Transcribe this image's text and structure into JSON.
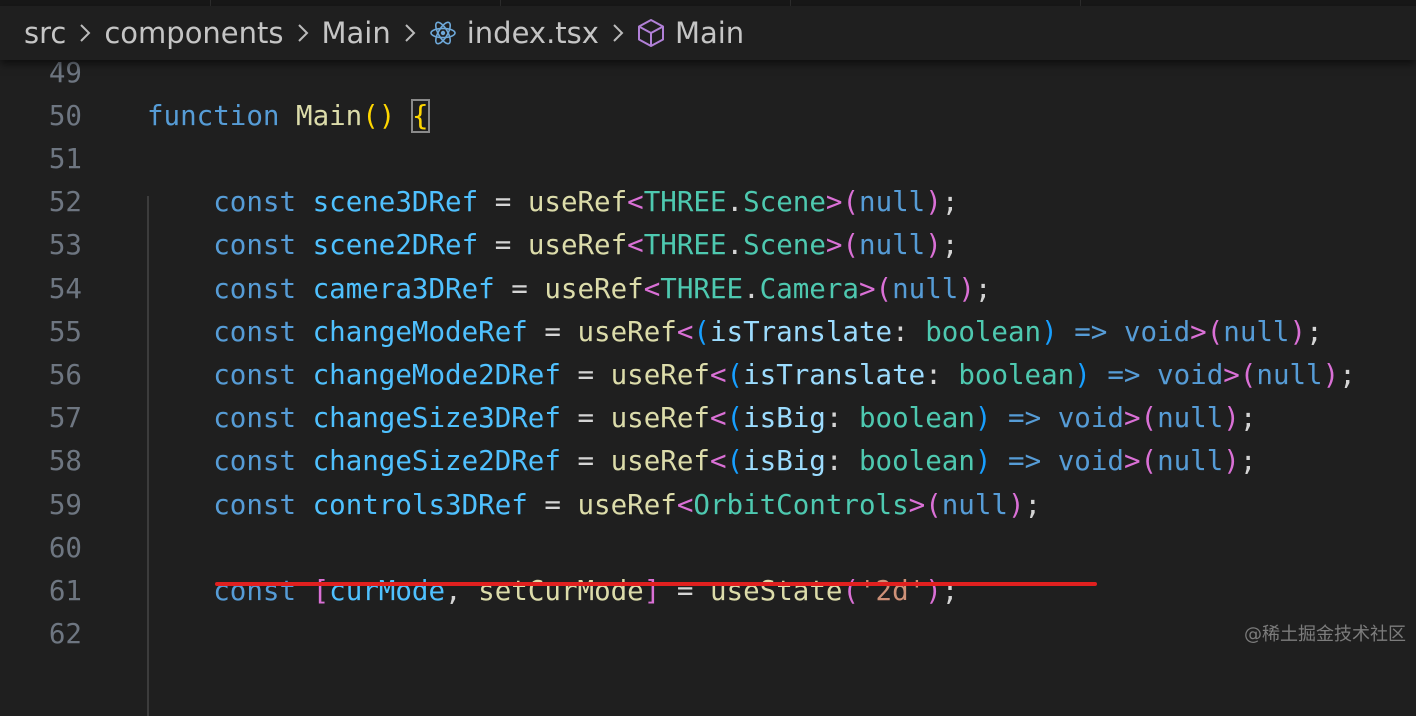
{
  "colors": {
    "background": "#1f1f1f",
    "line_number": "#6e7681",
    "keyword_blue": "#569cd6",
    "identifier": "#4fc1ff",
    "variable": "#9cdcfe",
    "function": "#dcdcaa",
    "type": "#4ec9b0",
    "bracket_gold": "#ffd700",
    "bracket_pink": "#da70d6",
    "bracket_cyan": "#179fff",
    "string": "#ce9178",
    "punct": "#d4d4d4",
    "highlight_underline": "#e0201f"
  },
  "breadcrumb": {
    "items": [
      {
        "label": "src",
        "icon": null
      },
      {
        "label": "components",
        "icon": null
      },
      {
        "label": "Main",
        "icon": null
      },
      {
        "label": "index.tsx",
        "icon": "react-icon"
      },
      {
        "label": "Main",
        "icon": "cube-icon"
      }
    ],
    "separator_icon": "chevron-right-icon"
  },
  "code_lines": [
    {
      "n": "49",
      "tokens": []
    },
    {
      "n": "50",
      "tokens": [
        {
          "t": "function",
          "c": "keyword_blue"
        },
        {
          "t": " ",
          "c": "punct"
        },
        {
          "t": "Main",
          "c": "function"
        },
        {
          "t": "()",
          "c": "bracket_gold"
        },
        {
          "t": " ",
          "c": "punct"
        },
        {
          "t": "{",
          "c": "bracket_gold",
          "box": true
        }
      ]
    },
    {
      "n": "51",
      "tokens": []
    },
    {
      "n": "52",
      "tokens": [
        {
          "t": "    const",
          "c": "keyword_blue"
        },
        {
          "t": " ",
          "c": "punct"
        },
        {
          "t": "scene3DRef",
          "c": "identifier"
        },
        {
          "t": " = ",
          "c": "punct"
        },
        {
          "t": "useRef",
          "c": "function"
        },
        {
          "t": "<",
          "c": "bracket_pink"
        },
        {
          "t": "THREE",
          "c": "type"
        },
        {
          "t": ".",
          "c": "punct"
        },
        {
          "t": "Scene",
          "c": "type"
        },
        {
          "t": ">",
          "c": "bracket_pink"
        },
        {
          "t": "(",
          "c": "bracket_pink"
        },
        {
          "t": "null",
          "c": "keyword_blue"
        },
        {
          "t": ")",
          "c": "bracket_pink"
        },
        {
          "t": ";",
          "c": "punct"
        }
      ]
    },
    {
      "n": "53",
      "tokens": [
        {
          "t": "    const",
          "c": "keyword_blue"
        },
        {
          "t": " ",
          "c": "punct"
        },
        {
          "t": "scene2DRef",
          "c": "identifier"
        },
        {
          "t": " = ",
          "c": "punct"
        },
        {
          "t": "useRef",
          "c": "function"
        },
        {
          "t": "<",
          "c": "bracket_pink"
        },
        {
          "t": "THREE",
          "c": "type"
        },
        {
          "t": ".",
          "c": "punct"
        },
        {
          "t": "Scene",
          "c": "type"
        },
        {
          "t": ">",
          "c": "bracket_pink"
        },
        {
          "t": "(",
          "c": "bracket_pink"
        },
        {
          "t": "null",
          "c": "keyword_blue"
        },
        {
          "t": ")",
          "c": "bracket_pink"
        },
        {
          "t": ";",
          "c": "punct"
        }
      ]
    },
    {
      "n": "54",
      "tokens": [
        {
          "t": "    const",
          "c": "keyword_blue"
        },
        {
          "t": " ",
          "c": "punct"
        },
        {
          "t": "camera3DRef",
          "c": "identifier"
        },
        {
          "t": " = ",
          "c": "punct"
        },
        {
          "t": "useRef",
          "c": "function"
        },
        {
          "t": "<",
          "c": "bracket_pink"
        },
        {
          "t": "THREE",
          "c": "type"
        },
        {
          "t": ".",
          "c": "punct"
        },
        {
          "t": "Camera",
          "c": "type"
        },
        {
          "t": ">",
          "c": "bracket_pink"
        },
        {
          "t": "(",
          "c": "bracket_pink"
        },
        {
          "t": "null",
          "c": "keyword_blue"
        },
        {
          "t": ")",
          "c": "bracket_pink"
        },
        {
          "t": ";",
          "c": "punct"
        }
      ]
    },
    {
      "n": "55",
      "tokens": [
        {
          "t": "    const",
          "c": "keyword_blue"
        },
        {
          "t": " ",
          "c": "punct"
        },
        {
          "t": "changeModeRef",
          "c": "identifier"
        },
        {
          "t": " = ",
          "c": "punct"
        },
        {
          "t": "useRef",
          "c": "function"
        },
        {
          "t": "<",
          "c": "bracket_pink"
        },
        {
          "t": "(",
          "c": "bracket_cyan"
        },
        {
          "t": "isTranslate",
          "c": "variable"
        },
        {
          "t": ": ",
          "c": "punct"
        },
        {
          "t": "boolean",
          "c": "type"
        },
        {
          "t": ")",
          "c": "bracket_cyan"
        },
        {
          "t": " => ",
          "c": "keyword_blue"
        },
        {
          "t": "void",
          "c": "keyword_blue"
        },
        {
          "t": ">",
          "c": "bracket_pink"
        },
        {
          "t": "(",
          "c": "bracket_pink"
        },
        {
          "t": "null",
          "c": "keyword_blue"
        },
        {
          "t": ")",
          "c": "bracket_pink"
        },
        {
          "t": ";",
          "c": "punct"
        }
      ]
    },
    {
      "n": "56",
      "tokens": [
        {
          "t": "    const",
          "c": "keyword_blue"
        },
        {
          "t": " ",
          "c": "punct"
        },
        {
          "t": "changeMode2DRef",
          "c": "identifier"
        },
        {
          "t": " = ",
          "c": "punct"
        },
        {
          "t": "useRef",
          "c": "function"
        },
        {
          "t": "<",
          "c": "bracket_pink"
        },
        {
          "t": "(",
          "c": "bracket_cyan"
        },
        {
          "t": "isTranslate",
          "c": "variable"
        },
        {
          "t": ": ",
          "c": "punct"
        },
        {
          "t": "boolean",
          "c": "type"
        },
        {
          "t": ")",
          "c": "bracket_cyan"
        },
        {
          "t": " => ",
          "c": "keyword_blue"
        },
        {
          "t": "void",
          "c": "keyword_blue"
        },
        {
          "t": ">",
          "c": "bracket_pink"
        },
        {
          "t": "(",
          "c": "bracket_pink"
        },
        {
          "t": "null",
          "c": "keyword_blue"
        },
        {
          "t": ")",
          "c": "bracket_pink"
        },
        {
          "t": ";",
          "c": "punct"
        }
      ]
    },
    {
      "n": "57",
      "tokens": [
        {
          "t": "    const",
          "c": "keyword_blue"
        },
        {
          "t": " ",
          "c": "punct"
        },
        {
          "t": "changeSize3DRef",
          "c": "identifier"
        },
        {
          "t": " = ",
          "c": "punct"
        },
        {
          "t": "useRef",
          "c": "function"
        },
        {
          "t": "<",
          "c": "bracket_pink"
        },
        {
          "t": "(",
          "c": "bracket_cyan"
        },
        {
          "t": "isBig",
          "c": "variable"
        },
        {
          "t": ": ",
          "c": "punct"
        },
        {
          "t": "boolean",
          "c": "type"
        },
        {
          "t": ")",
          "c": "bracket_cyan"
        },
        {
          "t": " => ",
          "c": "keyword_blue"
        },
        {
          "t": "void",
          "c": "keyword_blue"
        },
        {
          "t": ">",
          "c": "bracket_pink"
        },
        {
          "t": "(",
          "c": "bracket_pink"
        },
        {
          "t": "null",
          "c": "keyword_blue"
        },
        {
          "t": ")",
          "c": "bracket_pink"
        },
        {
          "t": ";",
          "c": "punct"
        }
      ]
    },
    {
      "n": "58",
      "tokens": [
        {
          "t": "    const",
          "c": "keyword_blue"
        },
        {
          "t": " ",
          "c": "punct"
        },
        {
          "t": "changeSize2DRef",
          "c": "identifier"
        },
        {
          "t": " = ",
          "c": "punct"
        },
        {
          "t": "useRef",
          "c": "function"
        },
        {
          "t": "<",
          "c": "bracket_pink"
        },
        {
          "t": "(",
          "c": "bracket_cyan"
        },
        {
          "t": "isBig",
          "c": "variable"
        },
        {
          "t": ": ",
          "c": "punct"
        },
        {
          "t": "boolean",
          "c": "type"
        },
        {
          "t": ")",
          "c": "bracket_cyan"
        },
        {
          "t": " => ",
          "c": "keyword_blue"
        },
        {
          "t": "void",
          "c": "keyword_blue"
        },
        {
          "t": ">",
          "c": "bracket_pink"
        },
        {
          "t": "(",
          "c": "bracket_pink"
        },
        {
          "t": "null",
          "c": "keyword_blue"
        },
        {
          "t": ")",
          "c": "bracket_pink"
        },
        {
          "t": ";",
          "c": "punct"
        }
      ]
    },
    {
      "n": "59",
      "tokens": [
        {
          "t": "    const",
          "c": "keyword_blue"
        },
        {
          "t": " ",
          "c": "punct"
        },
        {
          "t": "controls3DRef",
          "c": "identifier"
        },
        {
          "t": " = ",
          "c": "punct"
        },
        {
          "t": "useRef",
          "c": "function"
        },
        {
          "t": "<",
          "c": "bracket_pink"
        },
        {
          "t": "OrbitControls",
          "c": "type"
        },
        {
          "t": ">",
          "c": "bracket_pink"
        },
        {
          "t": "(",
          "c": "bracket_pink"
        },
        {
          "t": "null",
          "c": "keyword_blue"
        },
        {
          "t": ")",
          "c": "bracket_pink"
        },
        {
          "t": ";",
          "c": "punct"
        }
      ]
    },
    {
      "n": "60",
      "tokens": []
    },
    {
      "n": "61",
      "tokens": [
        {
          "t": "    const",
          "c": "keyword_blue"
        },
        {
          "t": " ",
          "c": "punct"
        },
        {
          "t": "[",
          "c": "bracket_pink"
        },
        {
          "t": "curMode",
          "c": "identifier"
        },
        {
          "t": ", ",
          "c": "punct"
        },
        {
          "t": "setCurMode",
          "c": "function"
        },
        {
          "t": "]",
          "c": "bracket_pink"
        },
        {
          "t": " = ",
          "c": "punct"
        },
        {
          "t": "useState",
          "c": "function"
        },
        {
          "t": "(",
          "c": "bracket_pink"
        },
        {
          "t": "'2d'",
          "c": "string"
        },
        {
          "t": ")",
          "c": "bracket_pink"
        },
        {
          "t": ";",
          "c": "punct"
        }
      ]
    },
    {
      "n": "62",
      "tokens": []
    }
  ],
  "watermark": "@稀土掘金技术社区"
}
